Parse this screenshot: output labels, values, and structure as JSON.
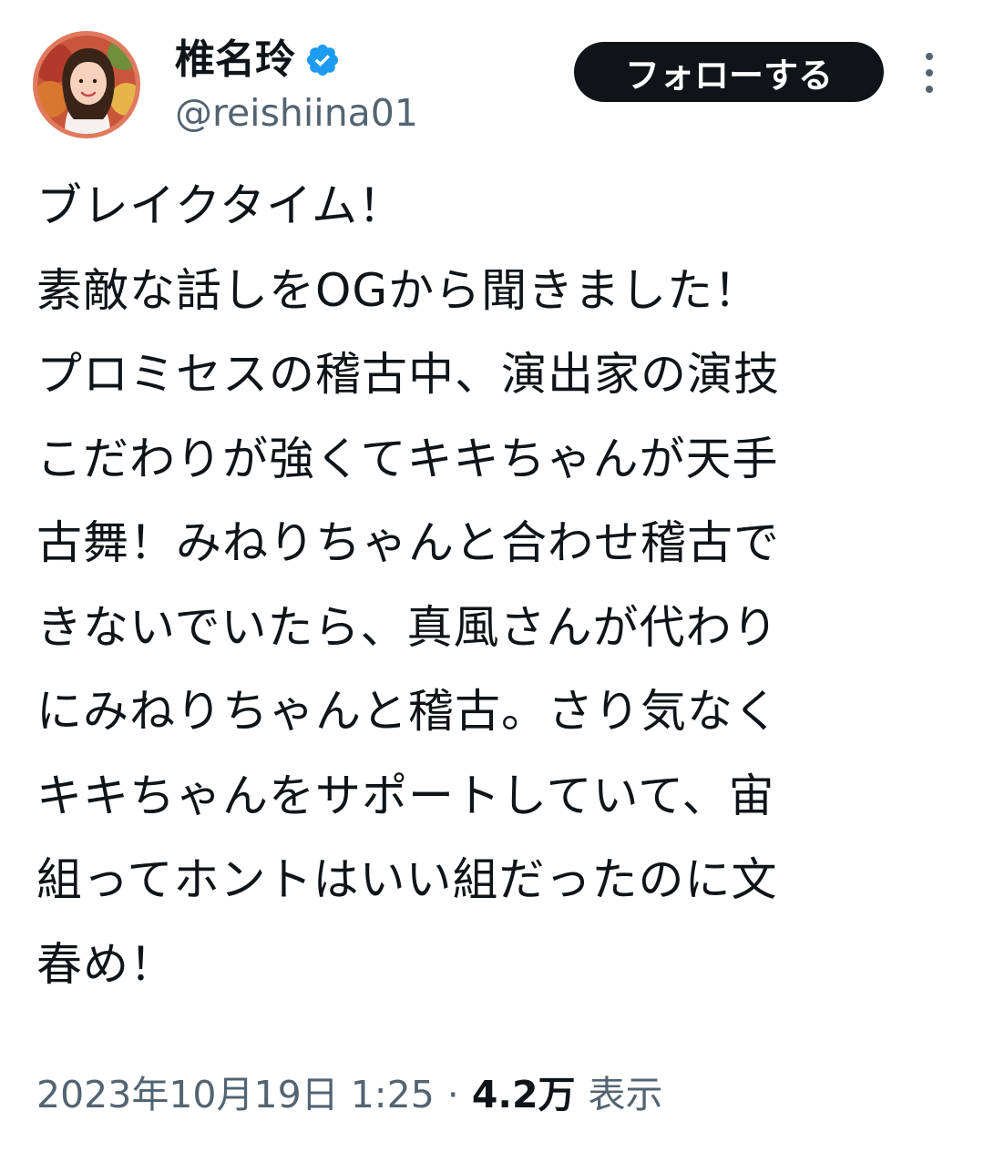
{
  "author": {
    "display_name": "椎名玲",
    "handle": "@reishiina01",
    "verified_icon": "verified-badge-icon",
    "verified_color": "#1d9bf0"
  },
  "actions": {
    "follow_label": "フォローする",
    "more_icon": "more-vertical-icon"
  },
  "tweet": {
    "lines": [
      "ブレイクタイム！",
      "素敵な話しをOGから聞きました！",
      "プロミセスの稽古中、演出家の演技",
      "こだわりが強くてキキちゃんが天手",
      "古舞！みねりちゃんと合わせ稽古で",
      "きないでいたら、真風さんが代わり",
      "にみねりちゃんと稽古。さり気なく",
      "キキちゃんをサポートしていて、宙",
      "組ってホントはいい組だったのに文",
      "春め！"
    ]
  },
  "meta": {
    "timestamp": "2023年10月19日 1:25",
    "separator": "·",
    "views_count": "4.2万",
    "views_label": "表示"
  },
  "colors": {
    "text_primary": "#0f1419",
    "text_secondary": "#536471",
    "button_bg": "#0f1419",
    "avatar_ring": "#e07a5f"
  }
}
